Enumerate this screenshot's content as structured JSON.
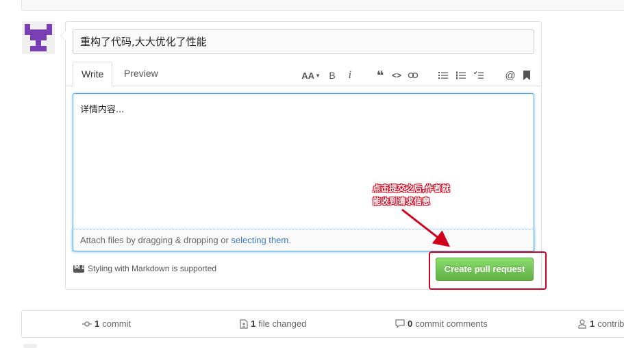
{
  "pr_form": {
    "title_value": "重构了代码,大大优化了性能",
    "tabs": [
      {
        "label": "Write",
        "active": true
      },
      {
        "label": "Preview",
        "active": false
      }
    ],
    "toolbar": {
      "heading": "AA",
      "bold": "B",
      "italic": "i",
      "quote": "❝",
      "code": "<>",
      "mention": "@"
    },
    "body_value": "详情内容...",
    "attach_text": "Attach files by dragging & dropping or ",
    "attach_link": "selecting them",
    "attach_end": ".",
    "markdown_note": "Styling with Markdown is supported",
    "markdown_badge": "M↓",
    "submit_label": "Create pull request"
  },
  "annotation": {
    "line1": "点击提交之后,作者就",
    "line2": "能收到请求信息",
    "color": "#d0021b"
  },
  "stats": [
    {
      "count": "1",
      "label": "commit",
      "icon": "commit-icon"
    },
    {
      "count": "1",
      "label": "file changed",
      "icon": "file-diff-icon"
    },
    {
      "count": "0",
      "label": "commit comments",
      "icon": "comment-icon"
    },
    {
      "count": "1",
      "label": "contribu",
      "icon": "contributors-icon"
    }
  ],
  "colors": {
    "accent_blue": "#4078c0",
    "focus_blue": "#51a7e8",
    "button_green": "#60b044",
    "avatar_purple": "#7b3fb5"
  }
}
